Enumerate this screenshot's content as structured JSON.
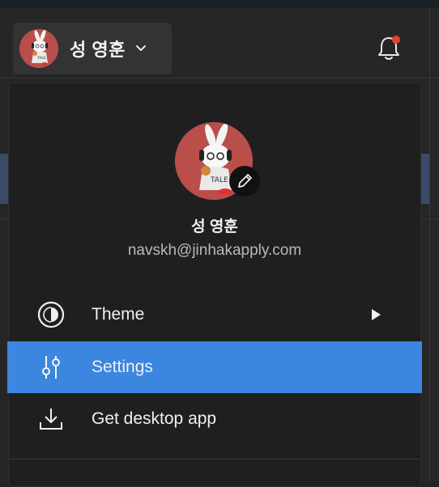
{
  "header": {
    "user_name": "성 영훈",
    "notification_dot_color": "#e2452f"
  },
  "profile_menu": {
    "name": "성 영훈",
    "email": "navskh@jinhakapply.com",
    "avatar_bg_color": "#b94e4a",
    "items": [
      {
        "label": "Theme",
        "icon": "theme-half-circle-icon",
        "has_submenu": true
      },
      {
        "label": "Settings",
        "icon": "sliders-icon",
        "active": true
      },
      {
        "label": "Get desktop app",
        "icon": "download-icon"
      }
    ],
    "active_color": "#3d86e0"
  }
}
